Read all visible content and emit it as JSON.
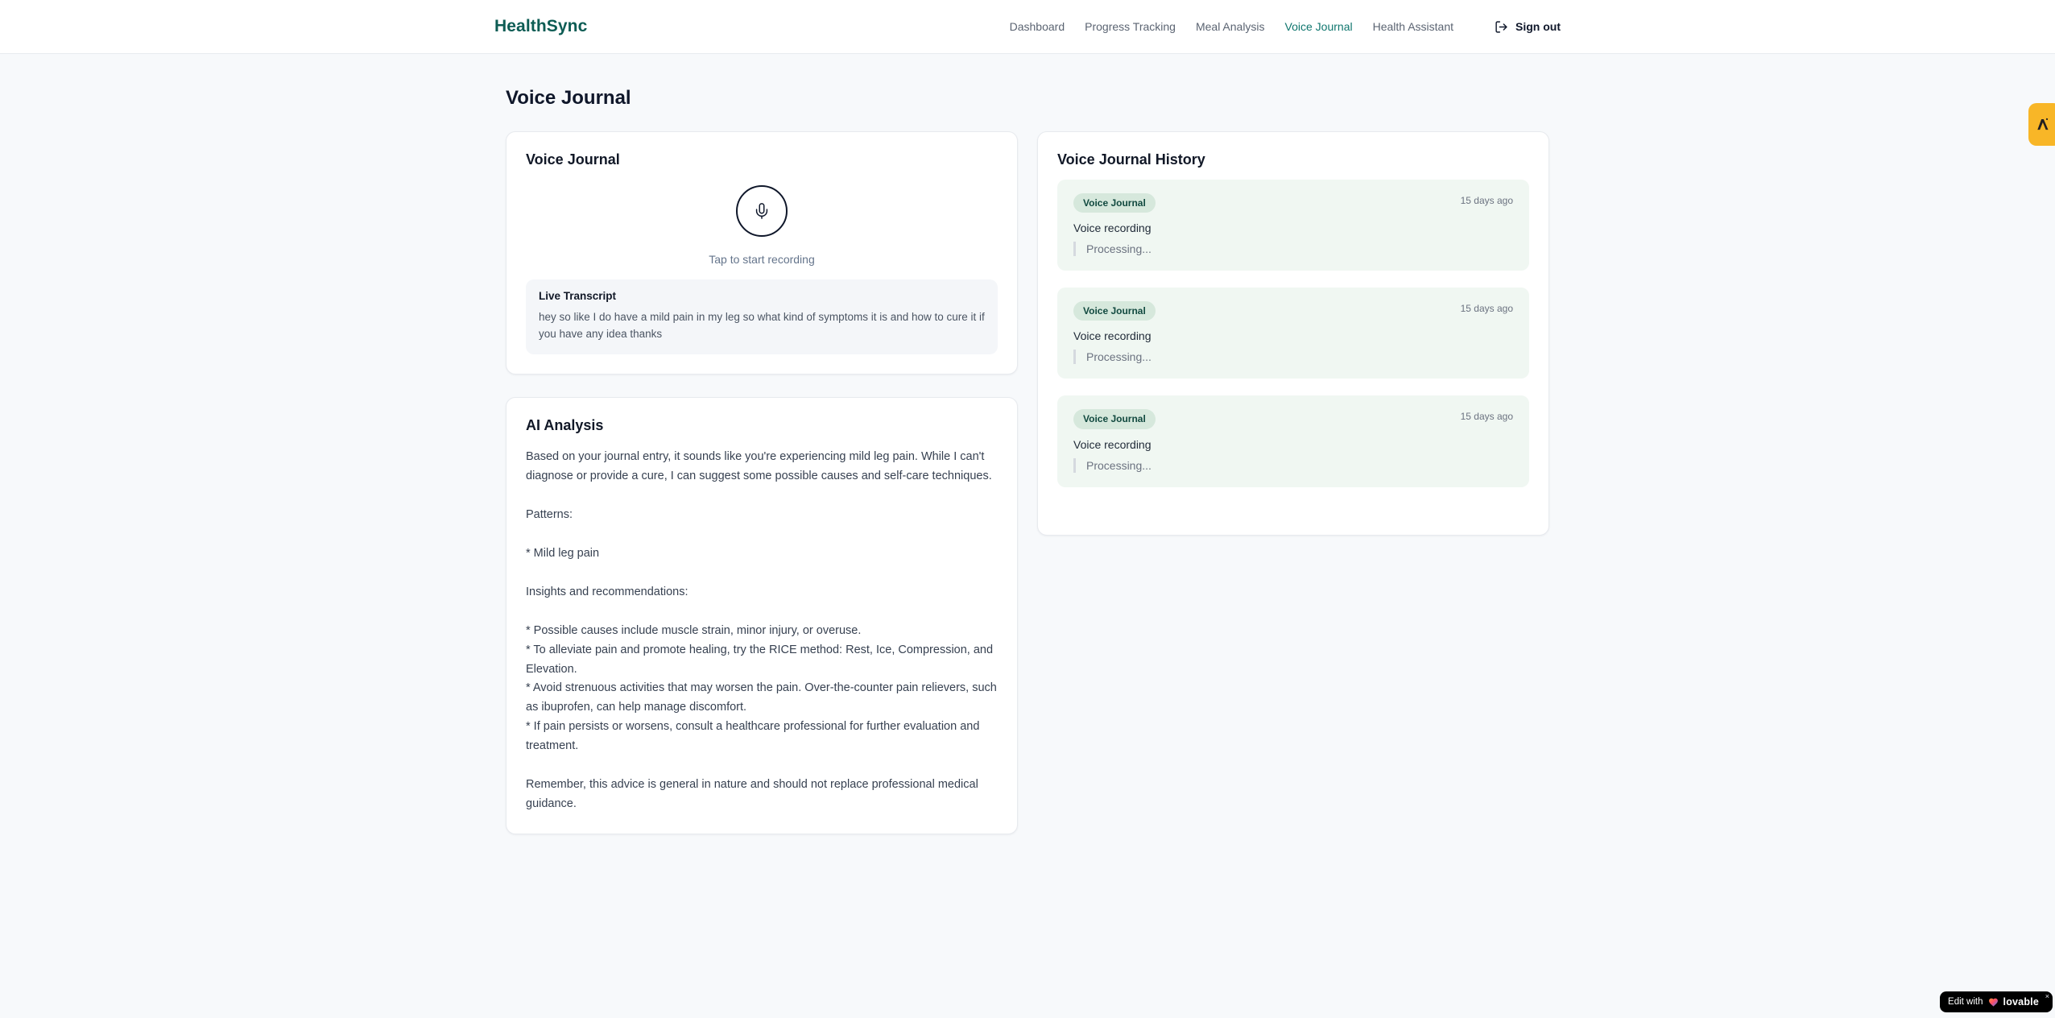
{
  "header": {
    "logo": "HealthSync",
    "nav": [
      {
        "label": "Dashboard",
        "active": false
      },
      {
        "label": "Progress Tracking",
        "active": false
      },
      {
        "label": "Meal Analysis",
        "active": false
      },
      {
        "label": "Voice Journal",
        "active": true
      },
      {
        "label": "Health Assistant",
        "active": false
      }
    ],
    "sign_out_label": "Sign out"
  },
  "page": {
    "title": "Voice Journal"
  },
  "recorder_card": {
    "title": "Voice Journal",
    "tap_hint": "Tap to start recording",
    "transcript_label": "Live Transcript",
    "transcript_text": "hey so like I do have a mild pain in my leg so what kind of symptoms it is and how to cure it if you have any idea thanks"
  },
  "analysis_card": {
    "title": "AI Analysis",
    "body": "Based on your journal entry, it sounds like you're experiencing mild leg pain. While I can't diagnose or provide a cure, I can suggest some possible causes and self-care techniques.\n\nPatterns:\n\n* Mild leg pain\n\nInsights and recommendations:\n\n* Possible causes include muscle strain, minor injury, or overuse.\n* To alleviate pain and promote healing, try the RICE method: Rest, Ice, Compression, and Elevation.\n* Avoid strenuous activities that may worsen the pain. Over-the-counter pain relievers, such as ibuprofen, can help manage discomfort.\n* If pain persists or worsens, consult a healthcare professional for further evaluation and treatment.\n\nRemember, this advice is general in nature and should not replace professional medical guidance."
  },
  "history_card": {
    "title": "Voice Journal History",
    "entries": [
      {
        "badge": "Voice Journal",
        "time": "15 days ago",
        "label": "Voice recording",
        "status": "Processing..."
      },
      {
        "badge": "Voice Journal",
        "time": "15 days ago",
        "label": "Voice recording",
        "status": "Processing..."
      },
      {
        "badge": "Voice Journal",
        "time": "15 days ago",
        "label": "Voice recording",
        "status": "Processing..."
      }
    ]
  },
  "overlays": {
    "edit_badge": {
      "prefix": "Edit with",
      "brand": "lovable",
      "close": "×"
    }
  },
  "icons": {
    "record": "microphone-icon",
    "sign_out": "log-out-icon",
    "edit_badge_heart": "gradient-heart-icon",
    "side_tab": "lambda-a-icon"
  },
  "colors": {
    "brand_teal": "#0d5c54",
    "active_nav": "#0f766e",
    "page_bg": "#f7f9fb",
    "entry_bg": "#f0f7f2",
    "badge_bg": "#d6e8dc",
    "badge_text": "#11493f",
    "side_tab_bg": "#f8b627",
    "edit_badge_bg": "#000000"
  }
}
